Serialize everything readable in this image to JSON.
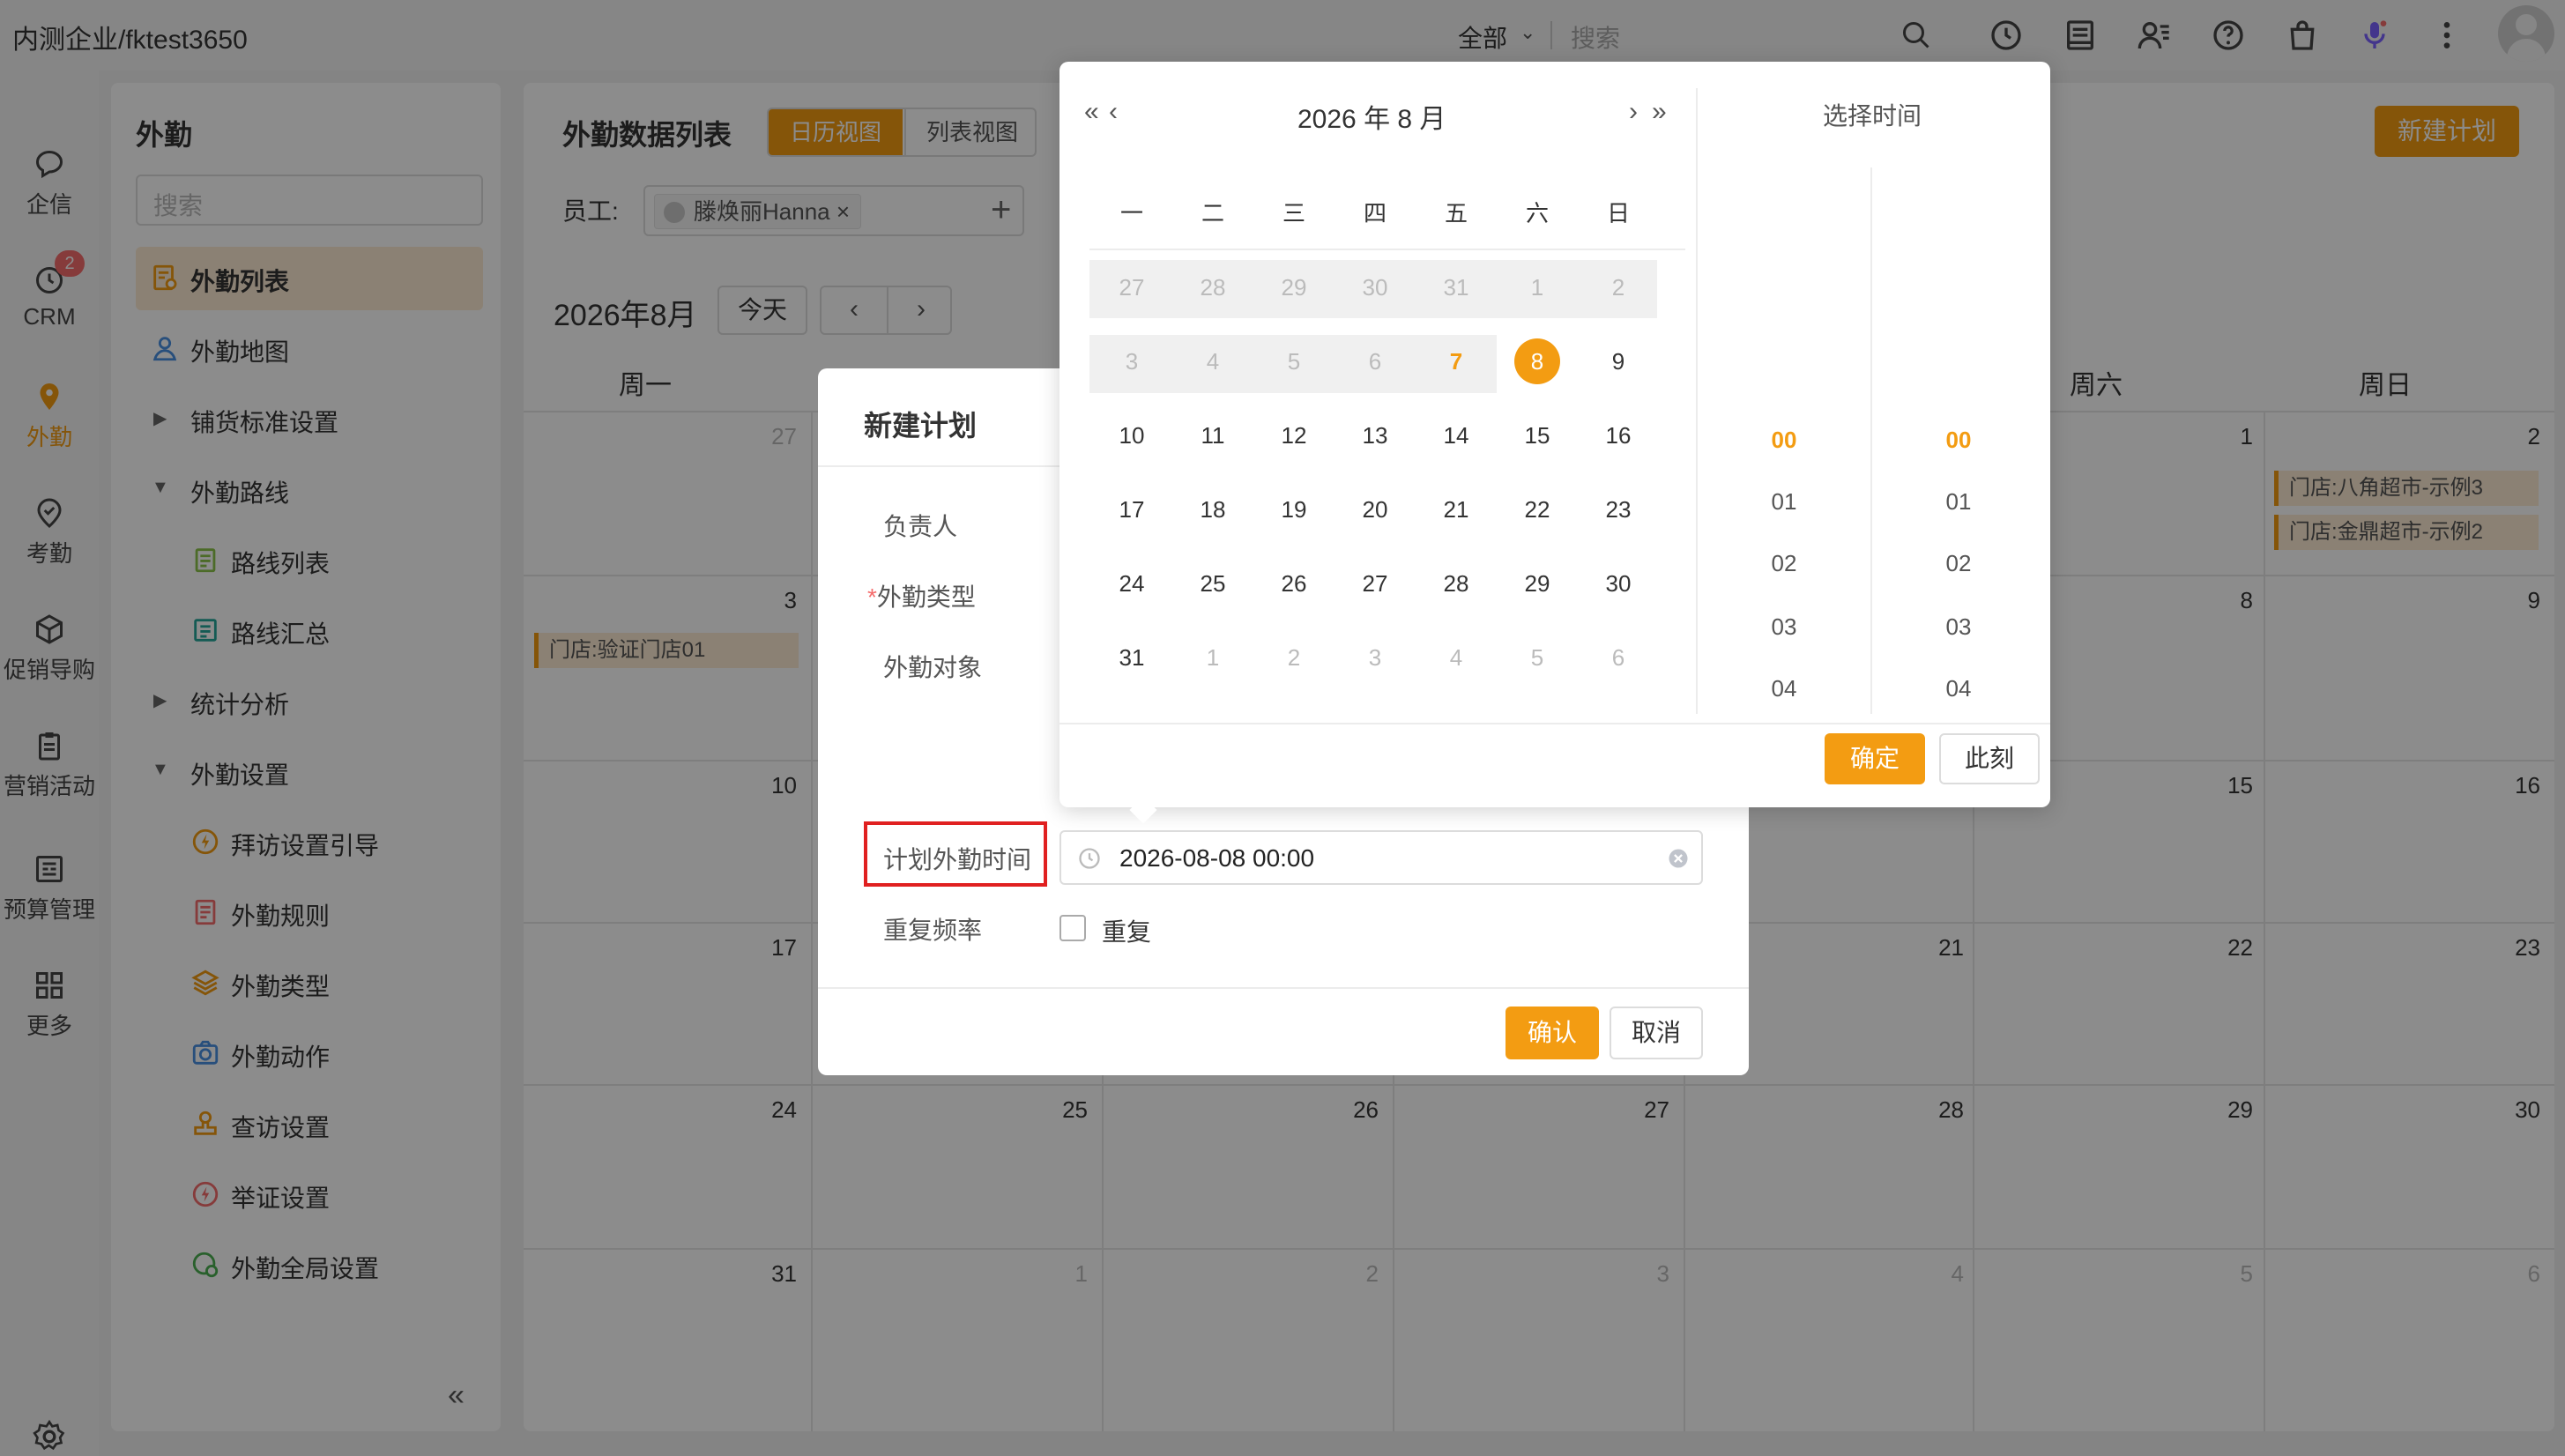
{
  "header": {
    "company": "内测企业/fktest3650",
    "search_scope": "全部",
    "search_placeholder": "搜索"
  },
  "leftnav": {
    "items": [
      {
        "label": "企信",
        "icon": "chat-bubble-icon"
      },
      {
        "label": "CRM",
        "icon": "clock-icon",
        "badge": "2"
      },
      {
        "label": "外勤",
        "icon": "location-pin-icon",
        "active": true
      },
      {
        "label": "考勤",
        "icon": "check-pin-icon"
      },
      {
        "label": "促销导购",
        "icon": "box-icon"
      },
      {
        "label": "营销活动",
        "icon": "clipboard-icon"
      },
      {
        "label": "预算管理",
        "icon": "budget-icon"
      },
      {
        "label": "更多",
        "icon": "grid-icon"
      }
    ]
  },
  "sidebar": {
    "title": "外勤",
    "search_placeholder": "搜索",
    "items": [
      {
        "label": "外勤列表"
      },
      {
        "label": "外勤地图"
      },
      {
        "label": "铺货标准设置"
      },
      {
        "label": "外勤路线"
      },
      {
        "label": "路线列表"
      },
      {
        "label": "路线汇总"
      },
      {
        "label": "统计分析"
      },
      {
        "label": "外勤设置"
      },
      {
        "label": "拜访设置引导"
      },
      {
        "label": "外勤规则"
      },
      {
        "label": "外勤类型"
      },
      {
        "label": "外勤动作"
      },
      {
        "label": "查访设置"
      },
      {
        "label": "举证设置"
      },
      {
        "label": "外勤全局设置"
      }
    ],
    "collapse": "«"
  },
  "main": {
    "title": "外勤数据列表",
    "tab_calendar": "日历视图",
    "tab_list": "列表视图",
    "new_plan": "新建计划",
    "employee_label": "员工:",
    "employee_tag": "滕焕丽Hanna ×",
    "plus": "+",
    "calendar_title": "2026年8月",
    "today": "今天",
    "prev": "‹",
    "next": "›",
    "weekdays": [
      "周一",
      "周六",
      "周日"
    ],
    "day_numbers": {
      "r1": [
        "27",
        "1",
        "2"
      ],
      "r2": [
        "3",
        "8",
        "9"
      ],
      "r3": [
        "10",
        "15",
        "16"
      ],
      "r4": [
        "17",
        "21",
        "22",
        "23"
      ],
      "r5": [
        "24",
        "25",
        "26",
        "27",
        "28",
        "29",
        "30"
      ],
      "r6": [
        "31",
        "1",
        "2",
        "3",
        "4",
        "5",
        "6"
      ]
    },
    "events": {
      "e1": "门店:验证门店01",
      "e2": "门店:八角超市-示例3",
      "e3": "门店:金鼎超市-示例2"
    }
  },
  "dialog": {
    "title": "新建计划",
    "owner_label": "负责人",
    "type_label_req": "*",
    "type_label": "外勤类型",
    "target_label": "外勤对象",
    "plan_time_label": "计划外勤时间",
    "plan_time_value": "2026-08-08 00:00",
    "repeat_label": "重复频率",
    "repeat_checkbox": "重复",
    "confirm": "确认",
    "cancel": "取消"
  },
  "picker": {
    "prev_year": "«",
    "prev_month": "‹",
    "next_month": "›",
    "next_year": "»",
    "year_month": "2026 年    8 月",
    "weekdays": [
      "一",
      "二",
      "三",
      "四",
      "五",
      "六",
      "日"
    ],
    "weeks": [
      [
        "27",
        "28",
        "29",
        "30",
        "31",
        "1",
        "2"
      ],
      [
        "3",
        "4",
        "5",
        "6",
        "7",
        "8",
        "9"
      ],
      [
        "10",
        "11",
        "12",
        "13",
        "14",
        "15",
        "16"
      ],
      [
        "17",
        "18",
        "19",
        "20",
        "21",
        "22",
        "23"
      ],
      [
        "24",
        "25",
        "26",
        "27",
        "28",
        "29",
        "30"
      ],
      [
        "31",
        "1",
        "2",
        "3",
        "4",
        "5",
        "6"
      ]
    ],
    "time_title": "选择时间",
    "hours": [
      "00",
      "01",
      "02",
      "03",
      "04"
    ],
    "minutes": [
      "00",
      "01",
      "02",
      "03",
      "04"
    ],
    "confirm": "确定",
    "now": "此刻"
  },
  "colors": {
    "accent": "#f39c12",
    "highlight": "#e02020",
    "badge": "#f56c6c"
  }
}
